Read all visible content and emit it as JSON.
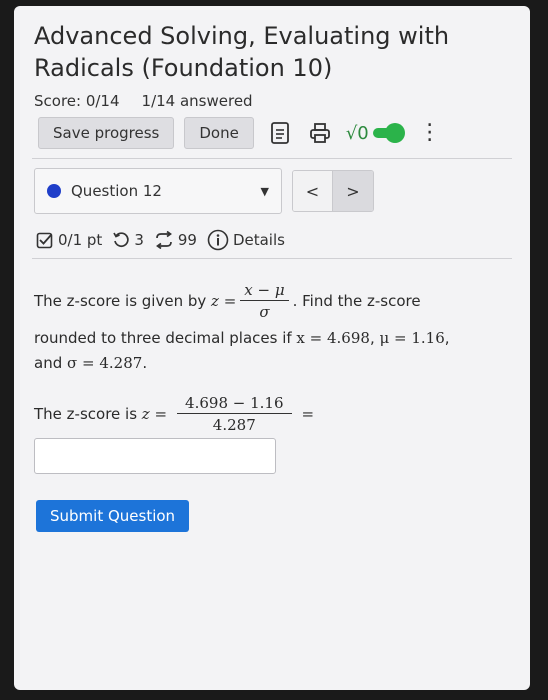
{
  "assignment": {
    "title": "Advanced Solving, Evaluating with Radicals (Foundation 10)",
    "score": "Score: 0/14",
    "answered": "1/14 answered"
  },
  "toolbar": {
    "save_label": "Save progress",
    "done_label": "Done",
    "sqrt_label": "√0",
    "toggle_on": true,
    "kebab": "⋮"
  },
  "question_nav": {
    "selected": "Question 12",
    "prev": "<",
    "next": ">",
    "status_color": "#1f3ec9"
  },
  "meta": {
    "points": "0/1 pt",
    "retries": "3",
    "attempts": "99",
    "details": "Details"
  },
  "question": {
    "intro": "The z-score is given by",
    "z_var": "z =",
    "numerator": "x − μ",
    "denominator": "σ",
    "after_frac": ". Find the z-score",
    "line2_text": "rounded to three decimal places if",
    "x_value": "x = 4.698",
    "mu_value": "μ = 1.16",
    "and_text": "and",
    "sigma_value": "σ = 4.287",
    "period": "."
  },
  "answer": {
    "label": "The z-score is",
    "z_var": "z =",
    "numerator": "4.698 − 1.16",
    "denominator": "4.287",
    "equals": "=",
    "input_value": ""
  },
  "submit_label": "Submit Question",
  "colors": {
    "accent": "#1d74d9",
    "toggle": "#2bb34a"
  }
}
